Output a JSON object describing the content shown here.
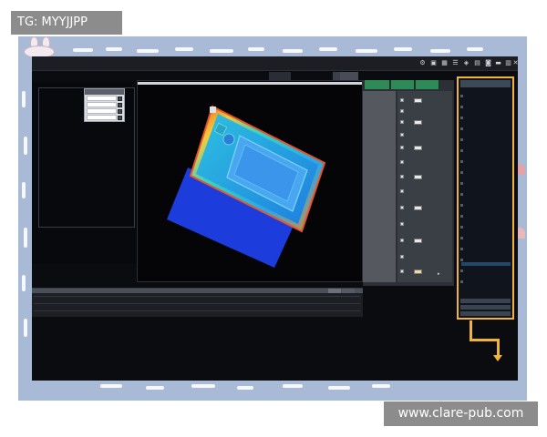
{
  "watermarks": {
    "top_left": "TG: MYYJJPP",
    "bottom_right": "www.clare-pub.com"
  },
  "colors": {
    "frame_bg": "#a9bad6",
    "screen_bg": "#0b0c10",
    "highlight": "#f0b43c",
    "tab_green": "#2e8b57",
    "selection_blue": "#254869"
  },
  "app": {
    "title_icons": [
      "gear-icon",
      "screen-icon",
      "grid-icon",
      "layers-icon",
      "cube-icon",
      "lock-icon",
      "camera-icon",
      "folder-icon",
      "save-icon",
      "trash-icon",
      "close-icon"
    ],
    "viewport_tabs": [
      "",
      "",
      ""
    ],
    "param_tabs": [
      "",
      "",
      ""
    ],
    "float_panel": {
      "rows": [
        "",
        "",
        "",
        ""
      ]
    },
    "icons": {
      "viewport_marker": "square-marker-icon",
      "close": "close-icon",
      "checkbox": "checkbox-icon",
      "expand": "expand-arrow-icon"
    }
  }
}
